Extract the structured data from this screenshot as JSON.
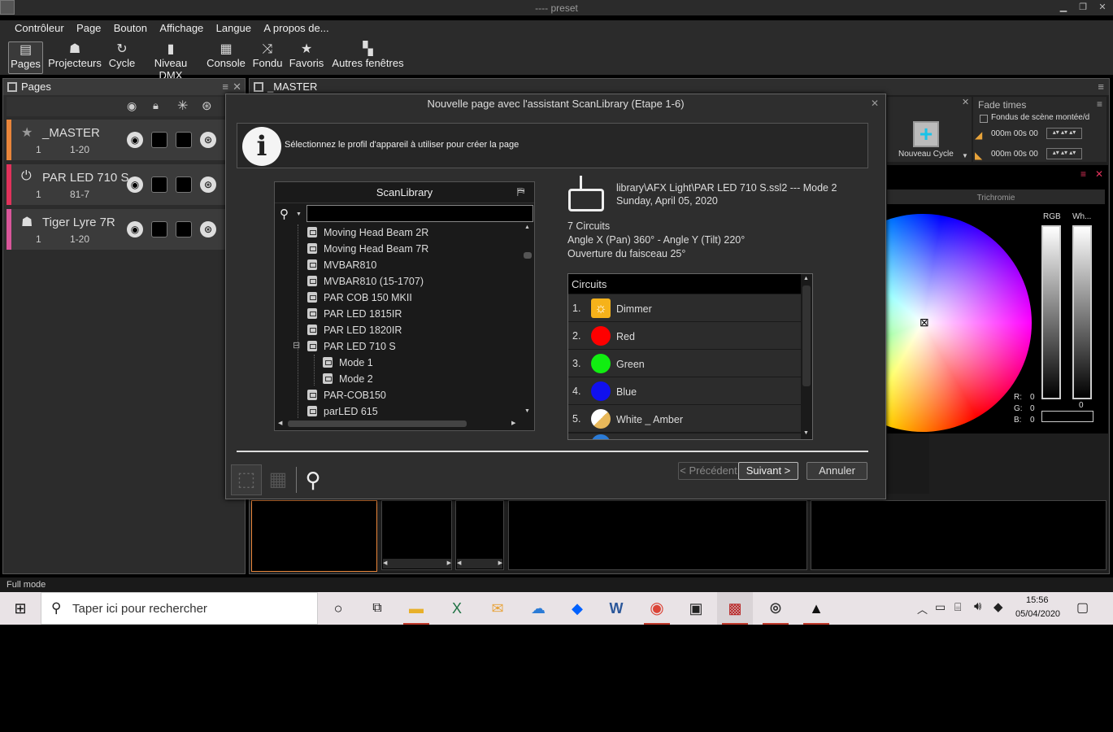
{
  "window": {
    "title": "---- preset"
  },
  "menu": [
    "Contrôleur",
    "Page",
    "Bouton",
    "Affichage",
    "Langue",
    "A propos de..."
  ],
  "toolbar": [
    {
      "label": "Pages",
      "icon": "pages-icon"
    },
    {
      "label": "Projecteurs",
      "icon": "projector-icon"
    },
    {
      "label": "Cycle",
      "icon": "cycle-icon"
    },
    {
      "label": "Niveau DMX",
      "icon": "dmx-icon"
    },
    {
      "label": "Console",
      "icon": "console-icon"
    },
    {
      "label": "Fondu",
      "icon": "shuffle-icon"
    },
    {
      "label": "Favoris",
      "icon": "star-icon"
    },
    {
      "label": "Autres fenêtres",
      "icon": "windows-icon"
    }
  ],
  "pages_panel": {
    "title": "Pages",
    "items": [
      {
        "name": "_MASTER",
        "num": "1",
        "range": "1-20",
        "color": "#e8853a"
      },
      {
        "name": "PAR LED 710 S",
        "num": "1",
        "range": "81-7",
        "color": "#e0325b"
      },
      {
        "name": "Tiger Lyre 7R",
        "num": "1",
        "range": "1-20",
        "color": "#d9569a"
      }
    ]
  },
  "main_tab": {
    "title": "_MASTER"
  },
  "fade": {
    "title": "Fade times",
    "checkbox_label": "Fondus de scène montée/d",
    "time1": "000m 00s 00",
    "time2": "000m 00s 00"
  },
  "new_cycle": {
    "label": "Nouveau Cycle"
  },
  "color_panel": {
    "title": "Trichromie",
    "rgb_label": "RGB",
    "wh_label": "Wh...",
    "r_label": "R:",
    "r_val": "0",
    "g_label": "G:",
    "g_val": "0",
    "b_label": "B:",
    "b_val": "0",
    "wh_val": "0",
    "accent": "#e0325b"
  },
  "dialog": {
    "title": "Nouvelle page avec l'assistant ScanLibrary (Etape 1-6)",
    "info": "Sélectionnez le profil d'appareil à utiliser pour créer la page",
    "library_title": "ScanLibrary",
    "search_value": "",
    "tree": [
      {
        "label": "Moving Head Beam 2R",
        "level": 0
      },
      {
        "label": "Moving Head Beam 7R",
        "level": 0
      },
      {
        "label": "MVBAR810",
        "level": 0
      },
      {
        "label": "MVBAR810 (15-1707)",
        "level": 0
      },
      {
        "label": "PAR COB 150 MKII",
        "level": 0
      },
      {
        "label": "PAR LED 1815IR",
        "level": 0
      },
      {
        "label": "PAR LED 1820IR",
        "level": 0
      },
      {
        "label": "PAR LED 710 S",
        "level": 0,
        "expanded": "⊟"
      },
      {
        "label": "Mode 1",
        "level": 1
      },
      {
        "label": "Mode 2",
        "level": 1
      },
      {
        "label": "PAR-COB150",
        "level": 0
      },
      {
        "label": "parLED 615",
        "level": 0
      }
    ],
    "fixture": {
      "path": "library\\AFX Light\\PAR LED 710 S.ssl2 --- Mode 2",
      "date": "Sunday, April 05, 2020",
      "circuits_count": "7 Circuits",
      "angles": "Angle X (Pan) 360° - Angle Y (Tilt) 220°",
      "beam": "Ouverture du faisceau 25°"
    },
    "circuits_title": "Circuits",
    "circuits": [
      {
        "num": "1.",
        "label": "Dimmer",
        "color": "#f6b21a"
      },
      {
        "num": "2.",
        "label": "Red",
        "color": "#ff0000"
      },
      {
        "num": "3.",
        "label": "Green",
        "color": "#11ee11"
      },
      {
        "num": "4.",
        "label": "Blue",
        "color": "#1010ee"
      },
      {
        "num": "5.",
        "label": "White _ Amber",
        "color": "#f3e6c4"
      }
    ],
    "buttons": {
      "prev": "< Précédent",
      "next": "Suivant >",
      "cancel": "Annuler"
    }
  },
  "statusbar": {
    "text": "Full mode"
  },
  "taskbar": {
    "search_placeholder": "Taper ici pour rechercher",
    "time": "15:56",
    "date": "05/04/2020"
  }
}
